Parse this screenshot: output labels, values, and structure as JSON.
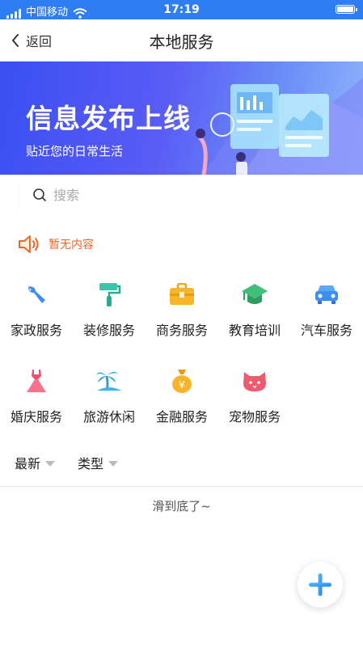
{
  "status_bar": {
    "carrier": "中国移动",
    "time": "17:19",
    "battery_level": 1.0
  },
  "navbar": {
    "back_label": "返回",
    "title": "本地服务"
  },
  "banner": {
    "headline": "信息发布上线",
    "subtitle": "贴近您的日常生活"
  },
  "search": {
    "placeholder": "搜索",
    "value": ""
  },
  "notice": {
    "text": "暂无内容"
  },
  "services": [
    {
      "label": "家政服务",
      "icon": "wrench-icon"
    },
    {
      "label": "装修服务",
      "icon": "paint-roller-icon"
    },
    {
      "label": "商务服务",
      "icon": "briefcase-icon"
    },
    {
      "label": "教育培训",
      "icon": "graduation-cap-icon"
    },
    {
      "label": "汽车服务",
      "icon": "car-icon"
    },
    {
      "label": "婚庆服务",
      "icon": "dress-icon"
    },
    {
      "label": "旅游休闲",
      "icon": "palm-island-icon"
    },
    {
      "label": "金融服务",
      "icon": "money-bag-icon"
    },
    {
      "label": "宠物服务",
      "icon": "cat-icon"
    }
  ],
  "filters": {
    "latest": "最新",
    "type": "类型"
  },
  "list_end_text": "滑到底了~",
  "colors": {
    "status_bar": "#2f7df2",
    "accent": "#2f7df2",
    "notice": "#f2632a"
  }
}
